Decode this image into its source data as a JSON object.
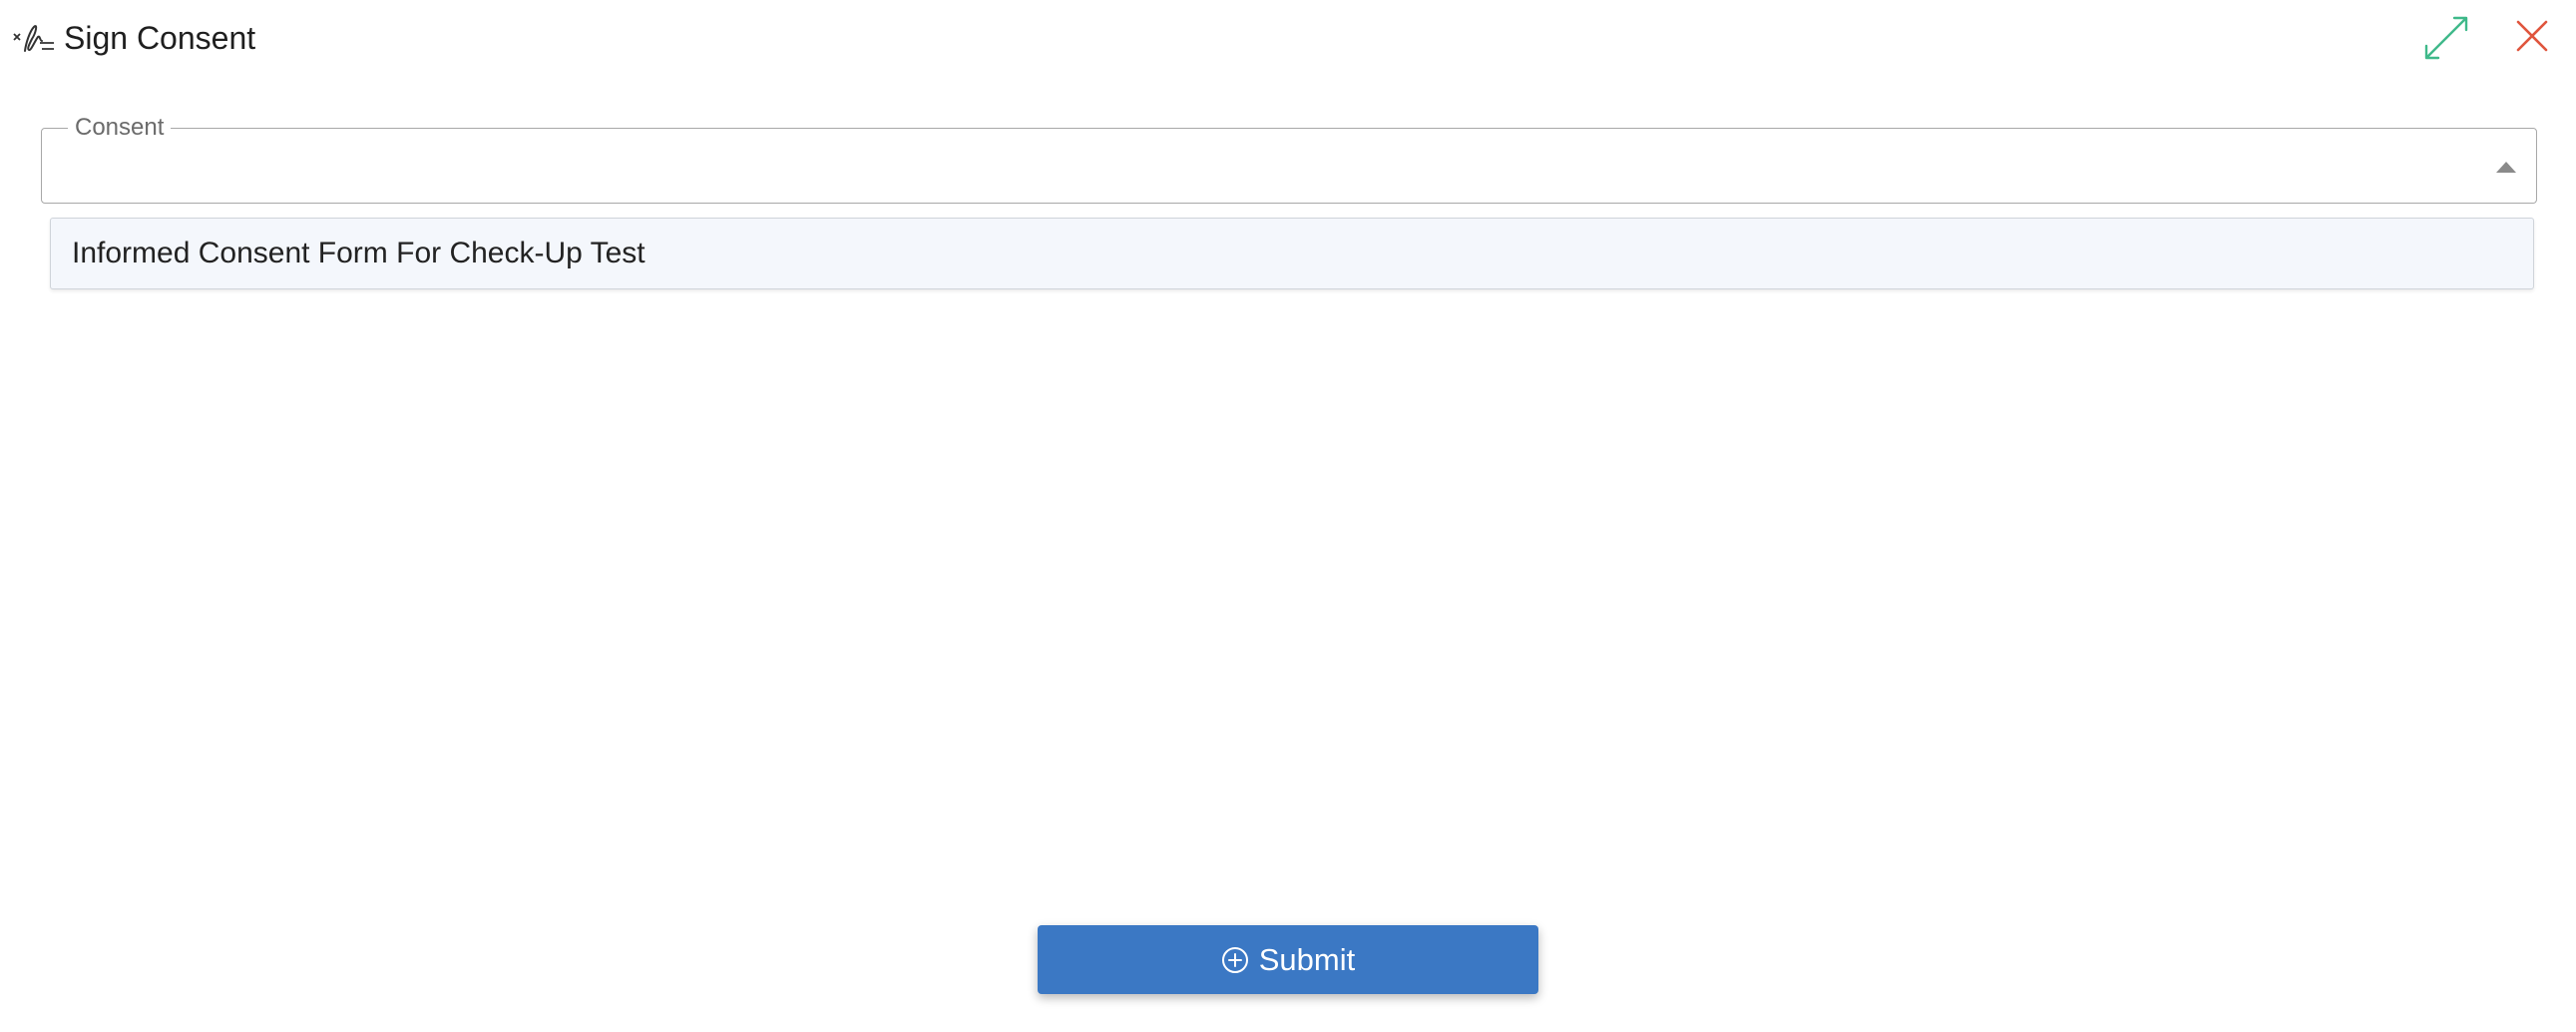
{
  "dialog": {
    "title": "Sign Consent",
    "icons": {
      "title_icon": "signature-icon",
      "expand_icon": "expand-icon",
      "close_icon": "close-icon"
    },
    "colors": {
      "expand_icon": "#3fb98a",
      "close_icon": "#e0553d"
    }
  },
  "consent_field": {
    "label": "Consent",
    "value": "",
    "placeholder": "",
    "icon": "caret-up-icon"
  },
  "dropdown": {
    "options": [
      {
        "label": "Informed Consent Form For Check-Up Test"
      }
    ]
  },
  "submit": {
    "label": "Submit",
    "icon": "plus-circle-icon",
    "color": "#3b78c4"
  }
}
